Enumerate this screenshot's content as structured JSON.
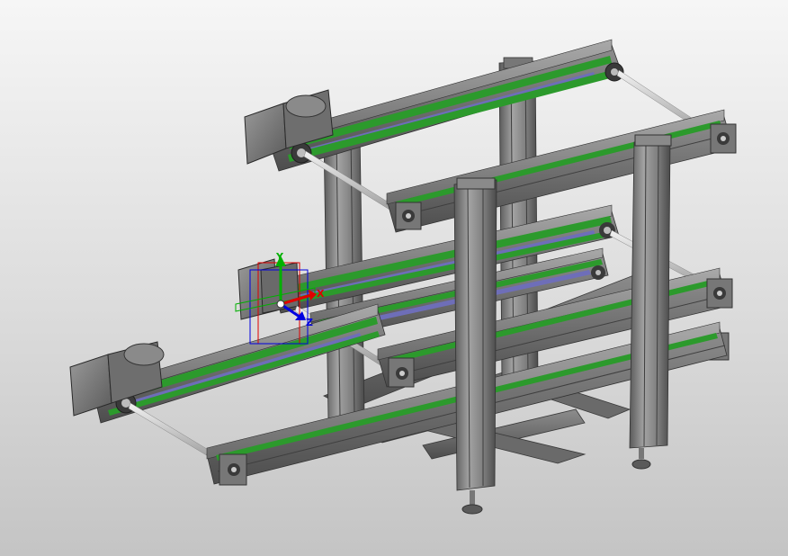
{
  "triad": {
    "x_label": "X",
    "y_label": "Y",
    "z_label": "Z"
  },
  "colors": {
    "background_top": "#f6f6f6",
    "background_bottom": "#c4c4c4",
    "frame_gray": "#7a7a7a",
    "belt_green": "#2c9a2c",
    "belt_blue": "#6e6eb8",
    "axis_x": "#e00000",
    "axis_y": "#00b000",
    "axis_z": "#0000e0"
  }
}
